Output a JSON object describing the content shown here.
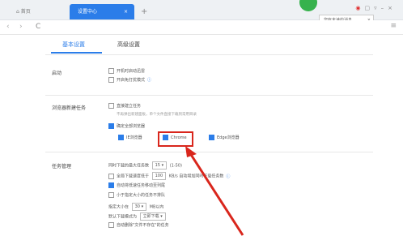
{
  "tabs": {
    "home": "首页",
    "active": "设置中心",
    "close": "×",
    "new": "+"
  },
  "badge": "",
  "notification": {
    "text": "您有未读的消息",
    "close": "×"
  },
  "nav": {
    "back": "‹",
    "forward": "›",
    "reload": "C",
    "menu": "≡"
  },
  "settings_tabs": {
    "basic": "基本设置",
    "advanced": "高级设置"
  },
  "startup": {
    "label": "启动",
    "options": [
      {
        "label": "开机时启动迅雷",
        "checked": false
      },
      {
        "label": "开启免打扰模式",
        "checked": false
      }
    ]
  },
  "browser_task": {
    "label": "浏览器新建任务",
    "direct": {
      "label": "直接建立任务",
      "checked": false
    },
    "hint": "不再弹出新建面板，单个文件直接下载到常用目录",
    "monitor_all": {
      "label": "确定全部浏览器",
      "checked": true
    },
    "browsers": [
      {
        "label": "IE浏览器",
        "checked": true
      },
      {
        "label": "Chrome",
        "checked": true
      },
      {
        "label": "Edge浏览器",
        "checked": true
      }
    ]
  },
  "task_mgmt": {
    "label": "任务管理",
    "max_tasks": {
      "prefix": "同时下载的最大任务数",
      "value": "15",
      "range": "(1-50)"
    },
    "speed_limit": {
      "prefix": "全局下载速度低于",
      "value": "100",
      "suffix": "KB/s 自动增加同时下载任务数",
      "checked": false
    },
    "auto_move": {
      "label": "自动将低速任务移动至列尾",
      "checked": true
    },
    "no_queue_small": {
      "label": "小于指定大小的任务不排队",
      "checked": false
    },
    "size": {
      "prefix": "指定大小在",
      "value": "30",
      "suffix": "MB以内"
    },
    "default_mode": {
      "prefix": "默认下载模式为",
      "value": "立即下载"
    },
    "auto_delete": {
      "label": "自动删除\"文件不存在\"的任务",
      "checked": false
    }
  },
  "icons": {
    "checked_color": "#2b7de9",
    "accent": "#2b7de9",
    "highlight": "#d9261c",
    "arrow": "#d9261c"
  }
}
